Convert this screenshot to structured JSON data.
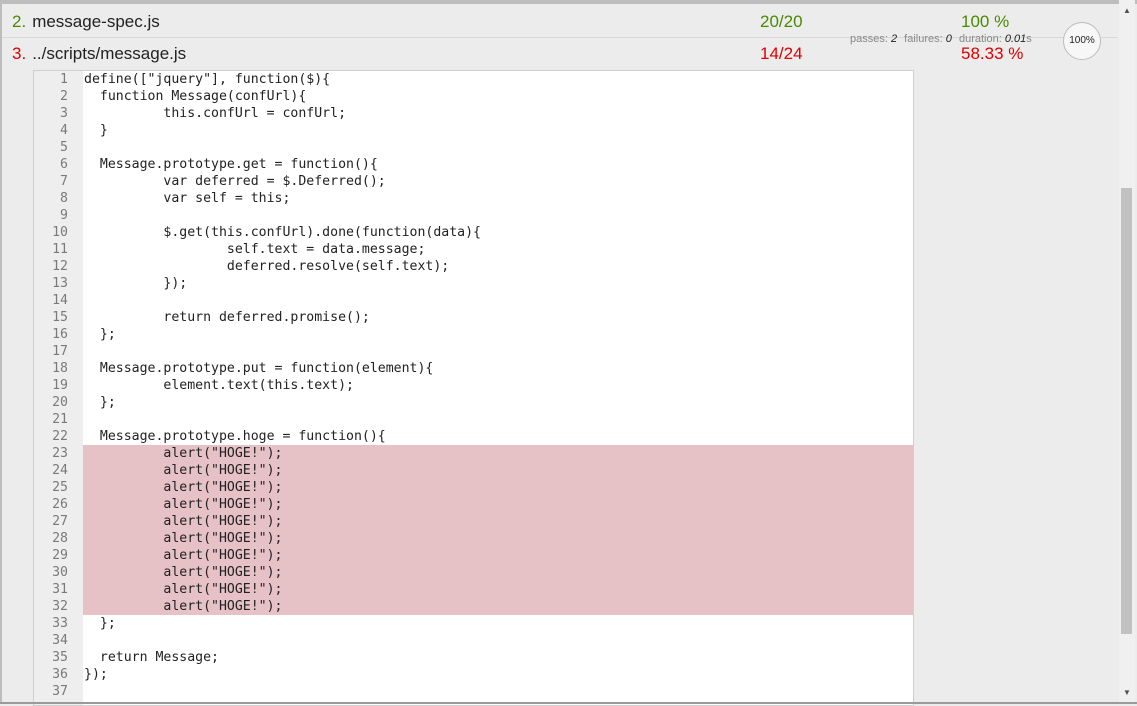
{
  "files": [
    {
      "num": "2.",
      "name": "message-spec.js",
      "count": "20/20",
      "percent": "100 %"
    },
    {
      "num": "3.",
      "name": "../scripts/message.js",
      "count": "14/24",
      "percent": "58.33 %"
    }
  ],
  "stats": {
    "passes_label": "passes:",
    "passes": "2",
    "failures_label": "failures:",
    "failures": "0",
    "duration_label": "duration:",
    "duration": "0.01",
    "duration_unit": "s",
    "progress": "100%"
  },
  "code": [
    {
      "n": "1",
      "t": "define([\"jquery\"], function($){",
      "miss": false
    },
    {
      "n": "2",
      "t": "  function Message(confUrl){",
      "miss": false
    },
    {
      "n": "3",
      "t": "          this.confUrl = confUrl;",
      "miss": false
    },
    {
      "n": "4",
      "t": "  }",
      "miss": false
    },
    {
      "n": "5",
      "t": "",
      "miss": false
    },
    {
      "n": "6",
      "t": "  Message.prototype.get = function(){",
      "miss": false
    },
    {
      "n": "7",
      "t": "          var deferred = $.Deferred();",
      "miss": false
    },
    {
      "n": "8",
      "t": "          var self = this;",
      "miss": false
    },
    {
      "n": "9",
      "t": "",
      "miss": false
    },
    {
      "n": "10",
      "t": "          $.get(this.confUrl).done(function(data){",
      "miss": false
    },
    {
      "n": "11",
      "t": "                  self.text = data.message;",
      "miss": false
    },
    {
      "n": "12",
      "t": "                  deferred.resolve(self.text);",
      "miss": false
    },
    {
      "n": "13",
      "t": "          });",
      "miss": false
    },
    {
      "n": "14",
      "t": "",
      "miss": false
    },
    {
      "n": "15",
      "t": "          return deferred.promise();",
      "miss": false
    },
    {
      "n": "16",
      "t": "  };",
      "miss": false
    },
    {
      "n": "17",
      "t": "",
      "miss": false
    },
    {
      "n": "18",
      "t": "  Message.prototype.put = function(element){",
      "miss": false
    },
    {
      "n": "19",
      "t": "          element.text(this.text);",
      "miss": false
    },
    {
      "n": "20",
      "t": "  };",
      "miss": false
    },
    {
      "n": "21",
      "t": "",
      "miss": false
    },
    {
      "n": "22",
      "t": "  Message.prototype.hoge = function(){",
      "miss": false
    },
    {
      "n": "23",
      "t": "          alert(\"HOGE!\");",
      "miss": true
    },
    {
      "n": "24",
      "t": "          alert(\"HOGE!\");",
      "miss": true
    },
    {
      "n": "25",
      "t": "          alert(\"HOGE!\");",
      "miss": true
    },
    {
      "n": "26",
      "t": "          alert(\"HOGE!\");",
      "miss": true
    },
    {
      "n": "27",
      "t": "          alert(\"HOGE!\");",
      "miss": true
    },
    {
      "n": "28",
      "t": "          alert(\"HOGE!\");",
      "miss": true
    },
    {
      "n": "29",
      "t": "          alert(\"HOGE!\");",
      "miss": true
    },
    {
      "n": "30",
      "t": "          alert(\"HOGE!\");",
      "miss": true
    },
    {
      "n": "31",
      "t": "          alert(\"HOGE!\");",
      "miss": true
    },
    {
      "n": "32",
      "t": "          alert(\"HOGE!\");",
      "miss": true
    },
    {
      "n": "33",
      "t": "  };",
      "miss": false
    },
    {
      "n": "34",
      "t": "",
      "miss": false
    },
    {
      "n": "35",
      "t": "  return Message;",
      "miss": false
    },
    {
      "n": "36",
      "t": "});",
      "miss": false
    },
    {
      "n": "37",
      "t": "",
      "miss": false
    }
  ],
  "scrollbar": {
    "up_icon": "▲",
    "down_icon": "▼"
  }
}
